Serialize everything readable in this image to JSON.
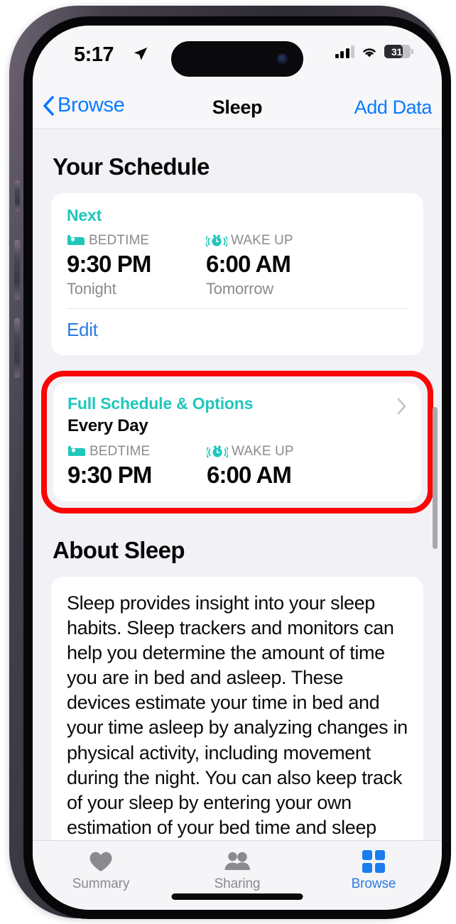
{
  "status_bar": {
    "time": "5:17",
    "location_icon": "location-arrow-icon",
    "cellular_icon": "signal-bars-icon",
    "wifi_icon": "wifi-icon",
    "battery_percent": "31"
  },
  "nav_bar": {
    "back_label": "Browse",
    "title": "Sleep",
    "action_label": "Add Data"
  },
  "your_schedule": {
    "heading": "Your Schedule",
    "next_card": {
      "eyebrow": "Next",
      "bedtime_label": "BEDTIME",
      "bedtime_time": "9:30 PM",
      "bedtime_when": "Tonight",
      "wakeup_label": "WAKE UP",
      "wakeup_time": "6:00 AM",
      "wakeup_when": "Tomorrow",
      "edit_label": "Edit"
    },
    "full_schedule_card": {
      "title": "Full Schedule & Options",
      "repeat": "Every Day",
      "bedtime_label": "BEDTIME",
      "bedtime_time": "9:30 PM",
      "wakeup_label": "WAKE UP",
      "wakeup_time": "6:00 AM",
      "highlighted": true
    }
  },
  "about_sleep": {
    "heading": "About Sleep",
    "body": "Sleep provides insight into your sleep habits. Sleep trackers and monitors can help you determine the amount of time you are in bed and asleep. These devices estimate your time in bed and your time asleep by analyzing changes in physical activity, including movement during the night. You can also keep track of your sleep by entering your own estimation of your bed time and sleep time manually."
  },
  "tab_bar": {
    "tabs": [
      {
        "label": "Summary",
        "icon": "heart-icon",
        "active": false
      },
      {
        "label": "Sharing",
        "icon": "people-icon",
        "active": false
      },
      {
        "label": "Browse",
        "icon": "grid-icon",
        "active": true
      }
    ]
  },
  "colors": {
    "accent_teal": "#1fc7bb",
    "link_blue": "#0a7aff",
    "annotation_red": "#f90606",
    "muted_gray": "#8b8b90"
  }
}
